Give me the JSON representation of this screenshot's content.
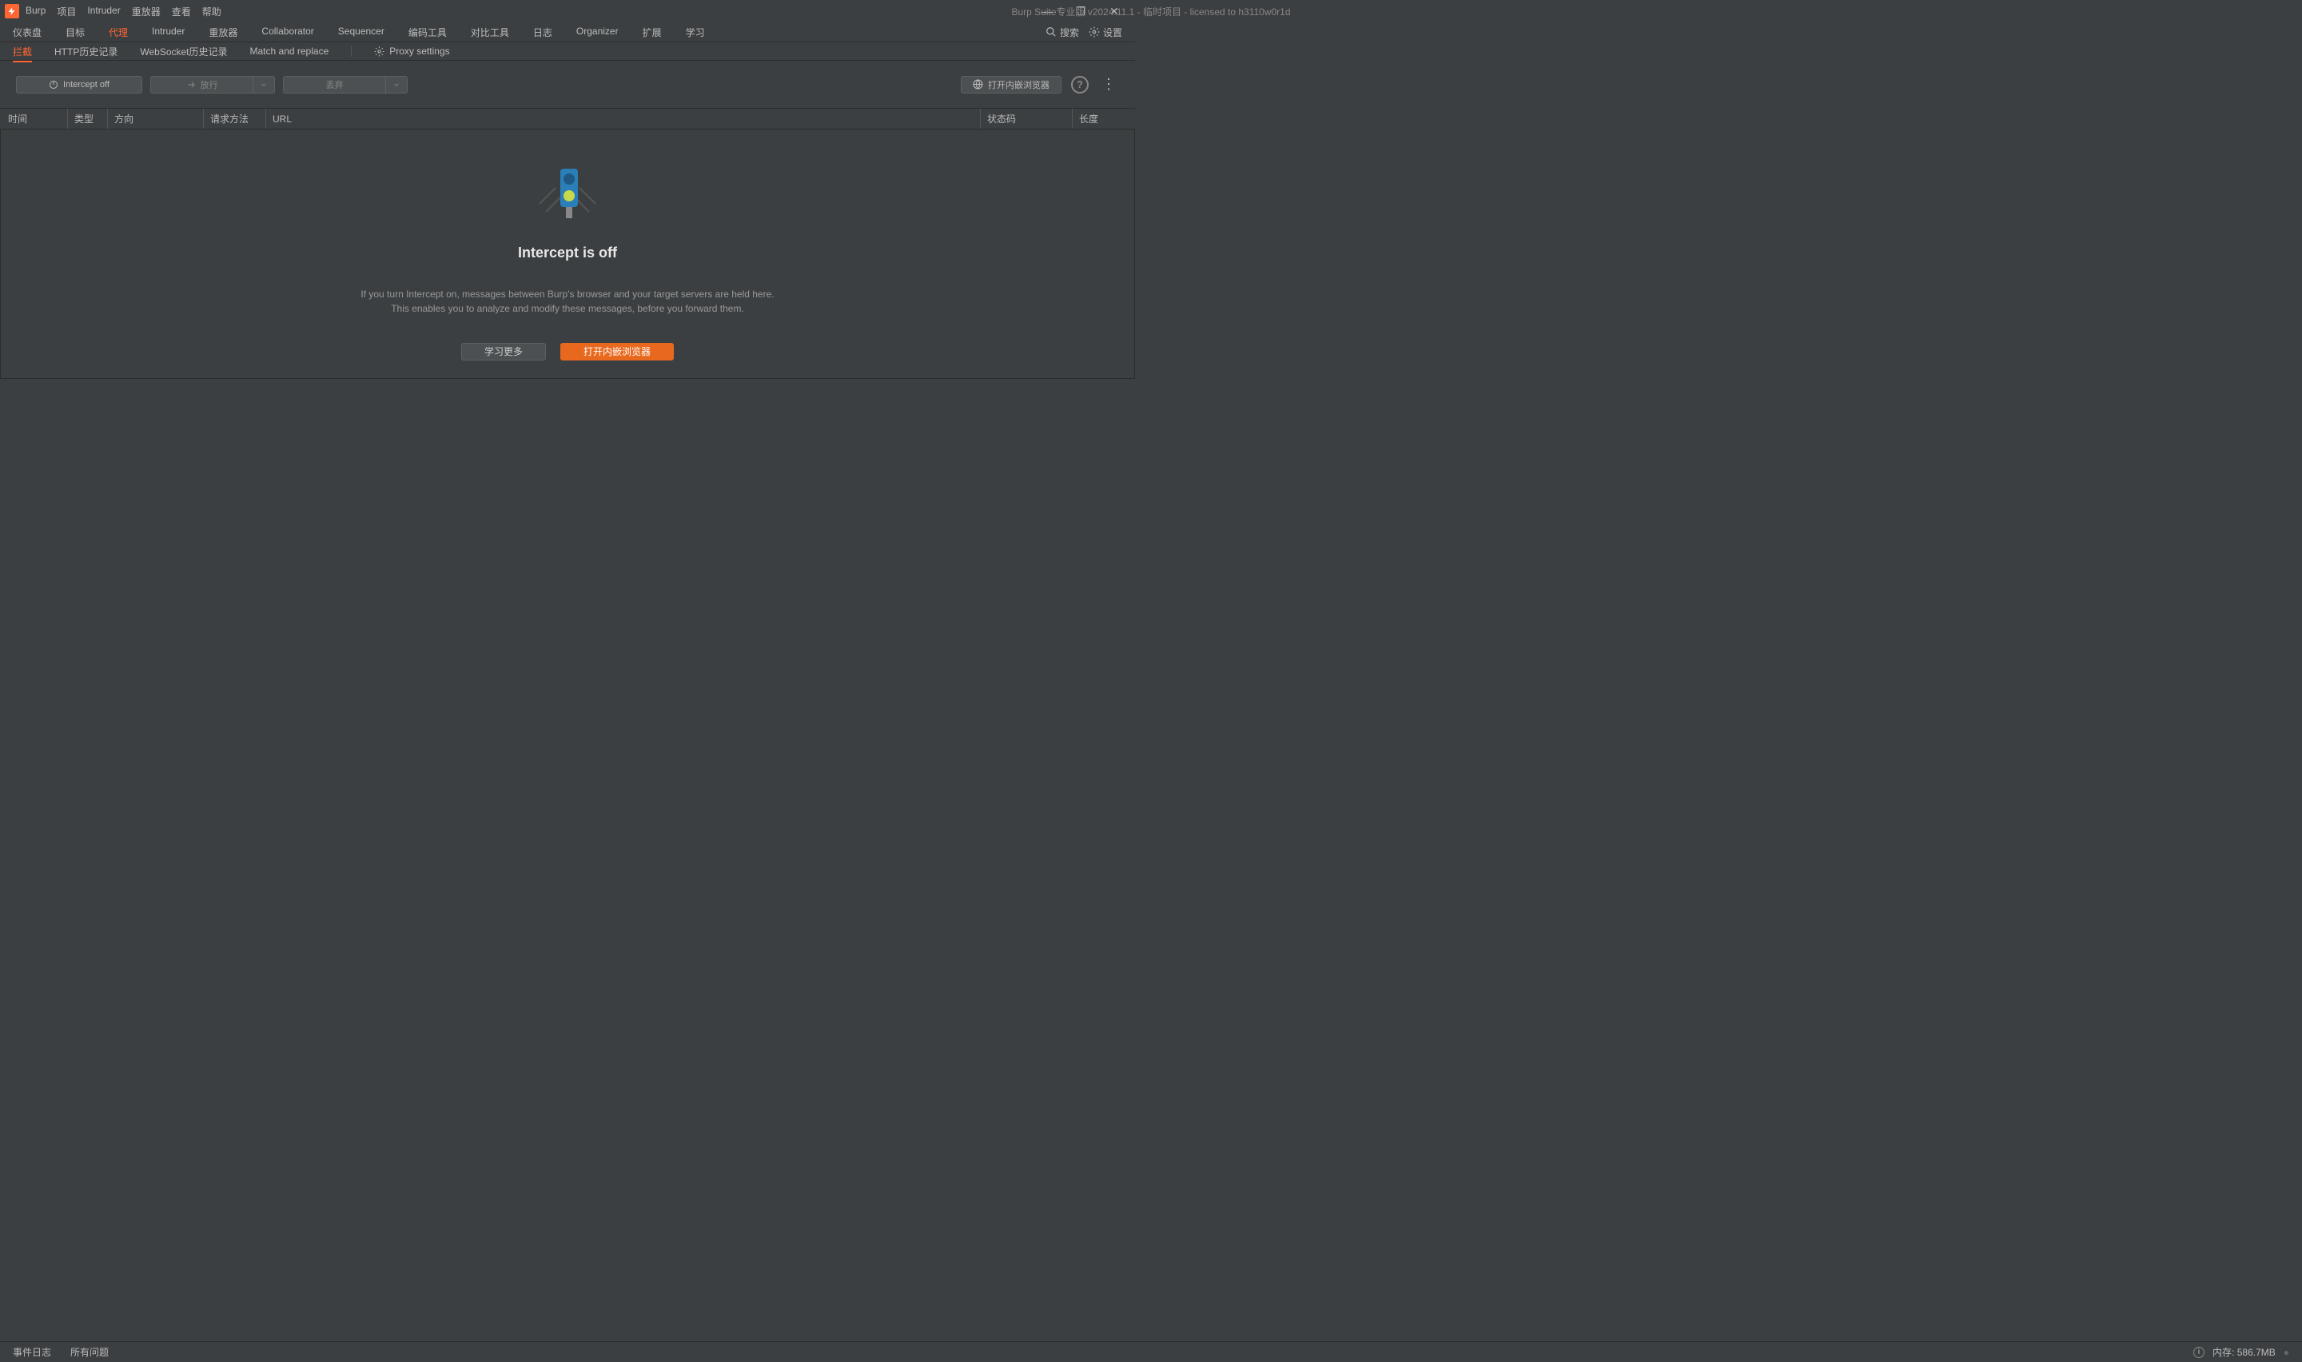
{
  "titlebar": {
    "menu": [
      "Burp",
      "项目",
      "Intruder",
      "重放器",
      "查看",
      "帮助"
    ],
    "title": "Burp Suite专业版  v2024.11.1 - 临时项目 - licensed to h3110w0r1d"
  },
  "mainTabs": {
    "items": [
      "仪表盘",
      "目标",
      "代理",
      "Intruder",
      "重放器",
      "Collaborator",
      "Sequencer",
      "编码工具",
      "对比工具",
      "日志",
      "Organizer",
      "扩展",
      "学习"
    ],
    "activeIndex": 2,
    "search": "搜索",
    "settings": "设置"
  },
  "subTabs": {
    "items": [
      "拦截",
      "HTTP历史记录",
      "WebSocket历史记录",
      "Match and replace"
    ],
    "activeIndex": 0,
    "proxySettings": "Proxy settings"
  },
  "toolbar": {
    "intercept": "Intercept off",
    "forward": "放行",
    "drop": "丢弃",
    "openBrowser": "打开内嵌浏览器"
  },
  "table": {
    "columns": {
      "time": "时间",
      "type": "类型",
      "direction": "方向",
      "method": "请求方法",
      "url": "URL",
      "status": "状态码",
      "length": "长度"
    }
  },
  "content": {
    "title": "Intercept is off",
    "desc1": "If you turn Intercept on, messages between Burp's browser and your target servers are held here.",
    "desc2": "This enables you to analyze and modify these messages, before you forward them.",
    "learnMore": "学习更多",
    "openBrowser": "打开内嵌浏览器"
  },
  "statusbar": {
    "eventLog": "事件日志",
    "allIssues": "所有问题",
    "memory": "内存: 586.7MB"
  }
}
